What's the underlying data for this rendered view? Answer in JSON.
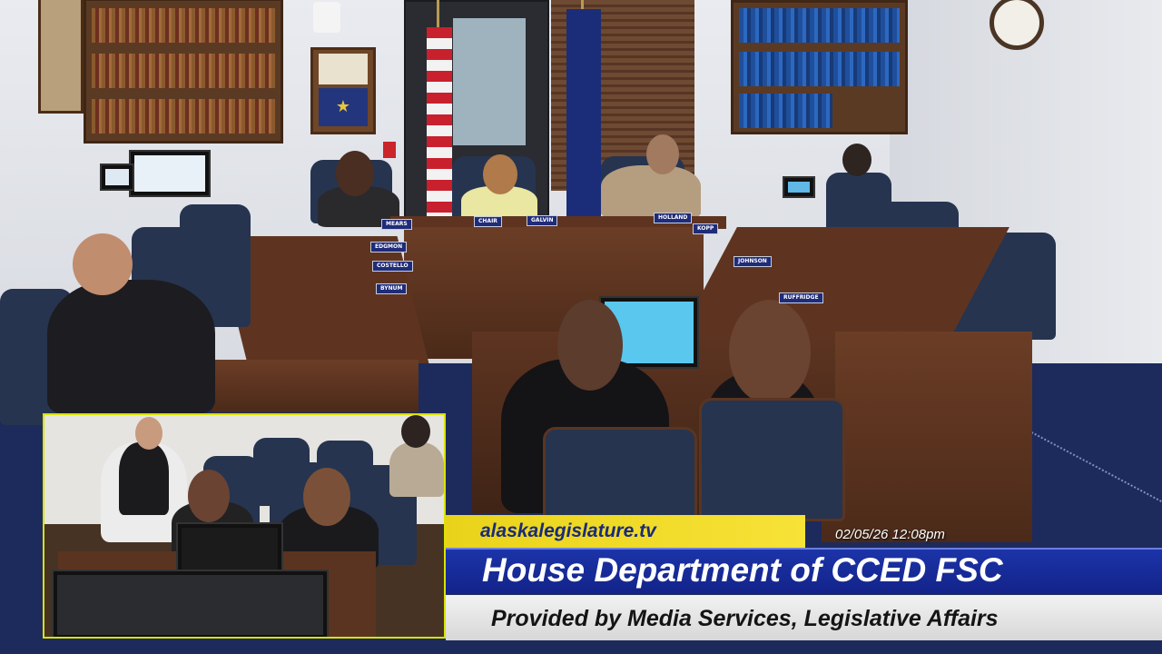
{
  "overlay": {
    "website": "alaskalegislature.tv",
    "timestamp": "02/05/26 12:08pm",
    "title": "House Department of CCED FSC",
    "provider": "Provided by Media Services, Legislative Affairs"
  },
  "nameplates": {
    "mears": "MEARS",
    "chair": "CHAIR",
    "galvin": "GALVIN",
    "holland": "HOLLAND",
    "kopp": "KOPP",
    "johnson": "JOHNSON",
    "ruffridge": "RUFFRIDGE",
    "edgmon": "EDGMON",
    "costello": "COSTELLO",
    "bynum": "BYNUM"
  },
  "colors": {
    "site_bar": "#f2dd2c",
    "title_bar": "#1a30a0",
    "provider_bar": "#e6e6e6",
    "pip_border": "#d9e300"
  }
}
